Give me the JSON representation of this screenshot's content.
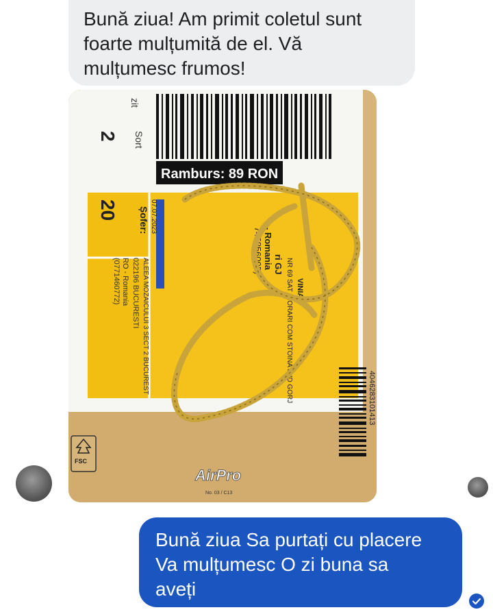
{
  "messages": [
    {
      "direction": "incoming",
      "lines": [
        "Bună ziua! Am primit coletul sunt",
        "foarte mulțumită de el. Vă",
        "mulțumesc frumos!"
      ]
    },
    {
      "direction": "outgoing",
      "lines": [
        "Bună ziua Sa purtați cu placere",
        "Va mulțumesc O zi buna sa",
        "aveți"
      ]
    }
  ],
  "photo": {
    "label_ramburs": "Ramburs: 89 RON",
    "label_sort": "Sort",
    "label_sort_value": "2",
    "label_zone": "20",
    "label_sofer": "Șofer:",
    "label_date": "07.07.2023",
    "label_phone": "(0771460772)",
    "label_country": "RO - Romania",
    "label_postcode": "022196 BUCURESTI",
    "label_street": "ALEEA MOZAICULUI 3 SECT 2 BUCUREST",
    "label_county": "ri GJ",
    "label_ro": "- Romania",
    "label_num": "745856095)",
    "label_addr": "NR 69 SAT CIORARI COM STOINA JUD GORJ",
    "label_vinia": "VINIA",
    "label_zit": "zit",
    "barcode_text": "4046283101413",
    "fsc_text": "FSC",
    "brand_text": "AirPro",
    "brand_sub": "No. 03 / C13"
  },
  "colors": {
    "incoming_bubble": "#eceef0",
    "outgoing_bubble": "#1b56c0",
    "label_yellow": "#f4c21a",
    "envelope": "#d8b57c",
    "chain_gold": "#c9a43a"
  }
}
